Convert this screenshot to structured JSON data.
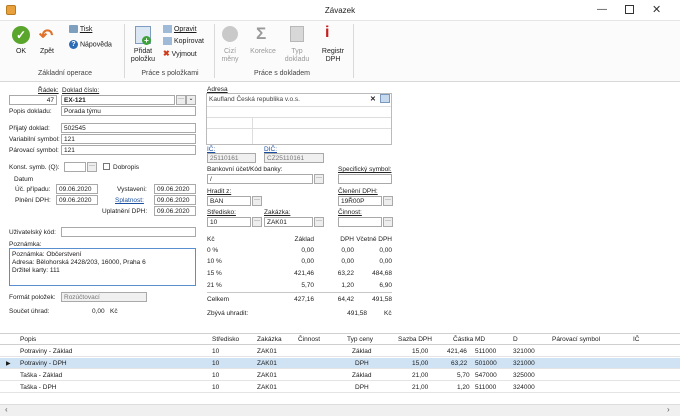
{
  "window": {
    "title": "Závazek"
  },
  "ribbon": {
    "ok": "OK",
    "back": "Zpět",
    "print": "Tisk",
    "help": "Nápověda",
    "group1": "Základní operace",
    "add_item": "Přidat\npoložku",
    "edit": "Opravit",
    "copy": "Kopírovat",
    "remove": "Vyjmout",
    "group2": "Práce s položkami",
    "foreign_currency": "Cizí\nměny",
    "correction": "Korekce",
    "doc_type": "Typ\ndokladu",
    "registry": "Registr\nDPH",
    "group3": "Práce s dokladem"
  },
  "form": {
    "row_label": "Řádek:",
    "row_value": "47",
    "doc_num_label": "Doklad číslo:",
    "doc_num_value": "EX-121",
    "desc_label": "Popis dokladu:",
    "desc_value": "Porada týmu",
    "received_label": "Přijatý doklad:",
    "received_value": "502545",
    "var_sym_label": "Variabilní symbol:",
    "var_sym_value": "121",
    "pair_sym_label": "Párovací symbol:",
    "pair_sym_value": "121",
    "const_sym_label": "Konst. symb. (Q):",
    "dobropis": "Dobropis",
    "dates_label": "Datum",
    "acc_case_label": "Úč. případu:",
    "acc_case_value": "09.06.2020",
    "vat_fulfil_label": "Plnění DPH:",
    "vat_fulfil_value": "09.06.2020",
    "issued_label": "Vystaveni:",
    "issued_value": "09.06.2020",
    "due_label": "Splatnost:",
    "due_value": "09.06.2020",
    "vat_apply_label": "Uplatnění DPH:",
    "vat_apply_value": "09.06.2020",
    "user_code_label": "Uživatelský kód:",
    "note_label": "Poznámka:",
    "note_lines": [
      "Poznámka: Občerstvení",
      "Adresa: Bělohorská 2428/203, 16000, Praha 6",
      "Držitel karty: 111"
    ],
    "item_format_label": "Formát položek:",
    "item_format_value": "Rozúčtovací",
    "sum_label": "Součet úhrad:",
    "sum_value": "0,00",
    "sum_currency": "Kč"
  },
  "address": {
    "label": "Adresa",
    "value": "Kaufland Česká republika v.o.s.",
    "ic_label": "IČ:",
    "ic_value": "25110161",
    "dic_label": "DIČ:",
    "dic_value": "CZ25110161"
  },
  "payment": {
    "bank_label": "Bankovní účet/Kód banky:",
    "bank_value": "/",
    "spec_sym_label": "Specifický symbol:",
    "paid_by_label": "Hradit z:",
    "paid_by_value": "BAN",
    "vat_class_label": "Členění DPH:",
    "vat_class_value": "19Ř00P",
    "center_label": "Středisko:",
    "center_value": "10",
    "order_label": "Zakázka:",
    "order_value": "ZAK01",
    "activity_label": "Činnost:"
  },
  "vat_table": {
    "headers": [
      "Kč",
      "Základ",
      "DPH",
      "Včetně DPH"
    ],
    "rows": [
      [
        "0 %",
        "0,00",
        "0,00",
        "0,00"
      ],
      [
        "10 %",
        "0,00",
        "0,00",
        "0,00"
      ],
      [
        "15 %",
        "421,46",
        "63,22",
        "484,68"
      ],
      [
        "21 %",
        "5,70",
        "1,20",
        "6,90"
      ],
      [
        "Celkem",
        "427,16",
        "64,42",
        "491,58"
      ]
    ],
    "remaining_label": "Zbývá uhradit:",
    "remaining_value": "491,58",
    "remaining_currency": "Kč"
  },
  "items": {
    "headers": [
      "Popis",
      "Středisko",
      "Zakázka",
      "Činnost",
      "Typ ceny",
      "Sazba DPH",
      "Částka",
      "MD",
      "D",
      "Párovací symbol",
      "IČ"
    ],
    "rows": [
      [
        "Potraviny - Základ",
        "10",
        "ZAK01",
        "",
        "Základ",
        "15,00",
        "421,46",
        "511000",
        "321000",
        "",
        ""
      ],
      [
        "Potraviny - DPH",
        "10",
        "ZAK01",
        "",
        "DPH",
        "15,00",
        "63,22",
        "501000",
        "321000",
        "",
        ""
      ],
      [
        "Taška - Základ",
        "10",
        "ZAK01",
        "",
        "Základ",
        "21,00",
        "5,70",
        "547000",
        "325000",
        "",
        ""
      ],
      [
        "Taška - DPH",
        "10",
        "ZAK01",
        "",
        "DPH",
        "21,00",
        "1,20",
        "511000",
        "324000",
        "",
        ""
      ]
    ]
  }
}
